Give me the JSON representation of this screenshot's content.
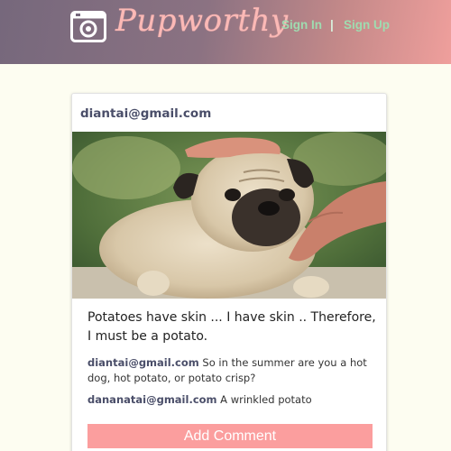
{
  "header": {
    "brand": "Pupworthy",
    "logo_icon": "camera-icon",
    "sign_in": "Sign In",
    "separator": "|",
    "sign_up": "Sign Up"
  },
  "post": {
    "author": "diantai@gmail.com",
    "image": "pug-photo",
    "caption": "Potatoes have skin ... I have skin .. Therefore, I must be a potato.",
    "comments": [
      {
        "user": "diantai@gmail.com",
        "text": "So in the summer are you a hot dog, hot potato, or potato crisp?"
      },
      {
        "user": "dananatai@gmail.com",
        "text": "A wrinkled potato"
      }
    ],
    "add_comment_label": "Add Comment"
  },
  "colors": {
    "header_start": "#76687c",
    "header_end": "#ef9f9c",
    "brand": "#fbb9b6",
    "nav": "#9fdcb0",
    "username": "#4a4e69",
    "button": "#fb9e9e",
    "background": "#fdfdf1"
  }
}
